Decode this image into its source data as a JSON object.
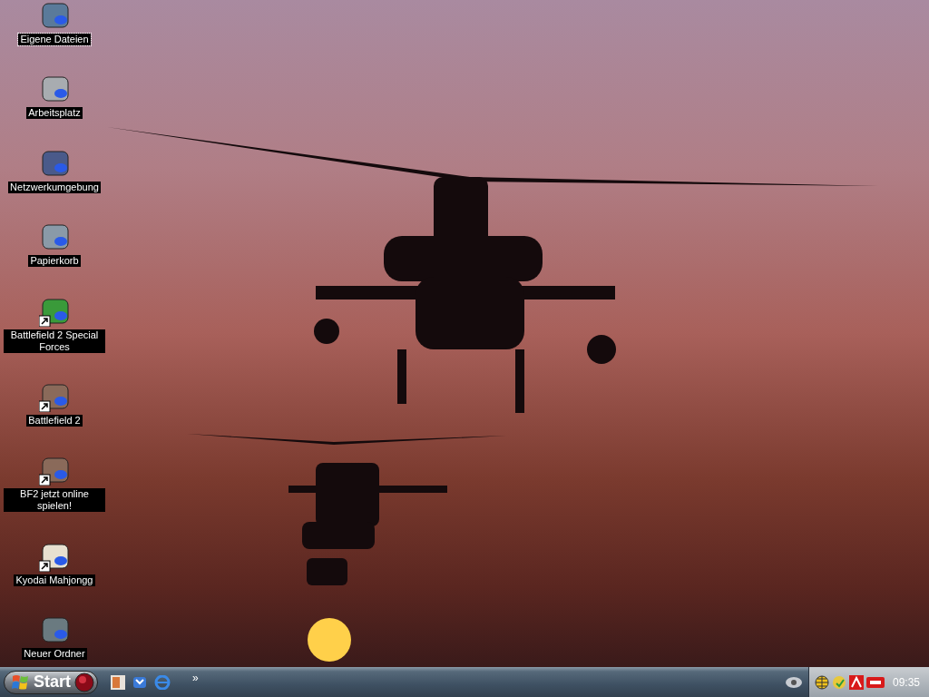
{
  "desktop": {
    "icons": [
      {
        "label": "Eigene Dateien",
        "shortcut": false,
        "selected": true
      },
      {
        "label": "Arbeitsplatz",
        "shortcut": false,
        "selected": false
      },
      {
        "label": "Netzwerkumgebung",
        "shortcut": false,
        "selected": false
      },
      {
        "label": "Papierkorb",
        "shortcut": false,
        "selected": false
      },
      {
        "label": "Battlefield 2 Special Forces",
        "shortcut": true,
        "selected": false
      },
      {
        "label": "Battlefield 2",
        "shortcut": true,
        "selected": false
      },
      {
        "label": "BF2 jetzt online spielen!",
        "shortcut": true,
        "selected": false
      },
      {
        "label": "Kyodai Mahjongg",
        "shortcut": true,
        "selected": false
      },
      {
        "label": "Neuer Ordner",
        "shortcut": false,
        "selected": false
      }
    ]
  },
  "taskbar": {
    "start_label": "Start",
    "quick_launch_more": "»",
    "clock": "09:35"
  }
}
